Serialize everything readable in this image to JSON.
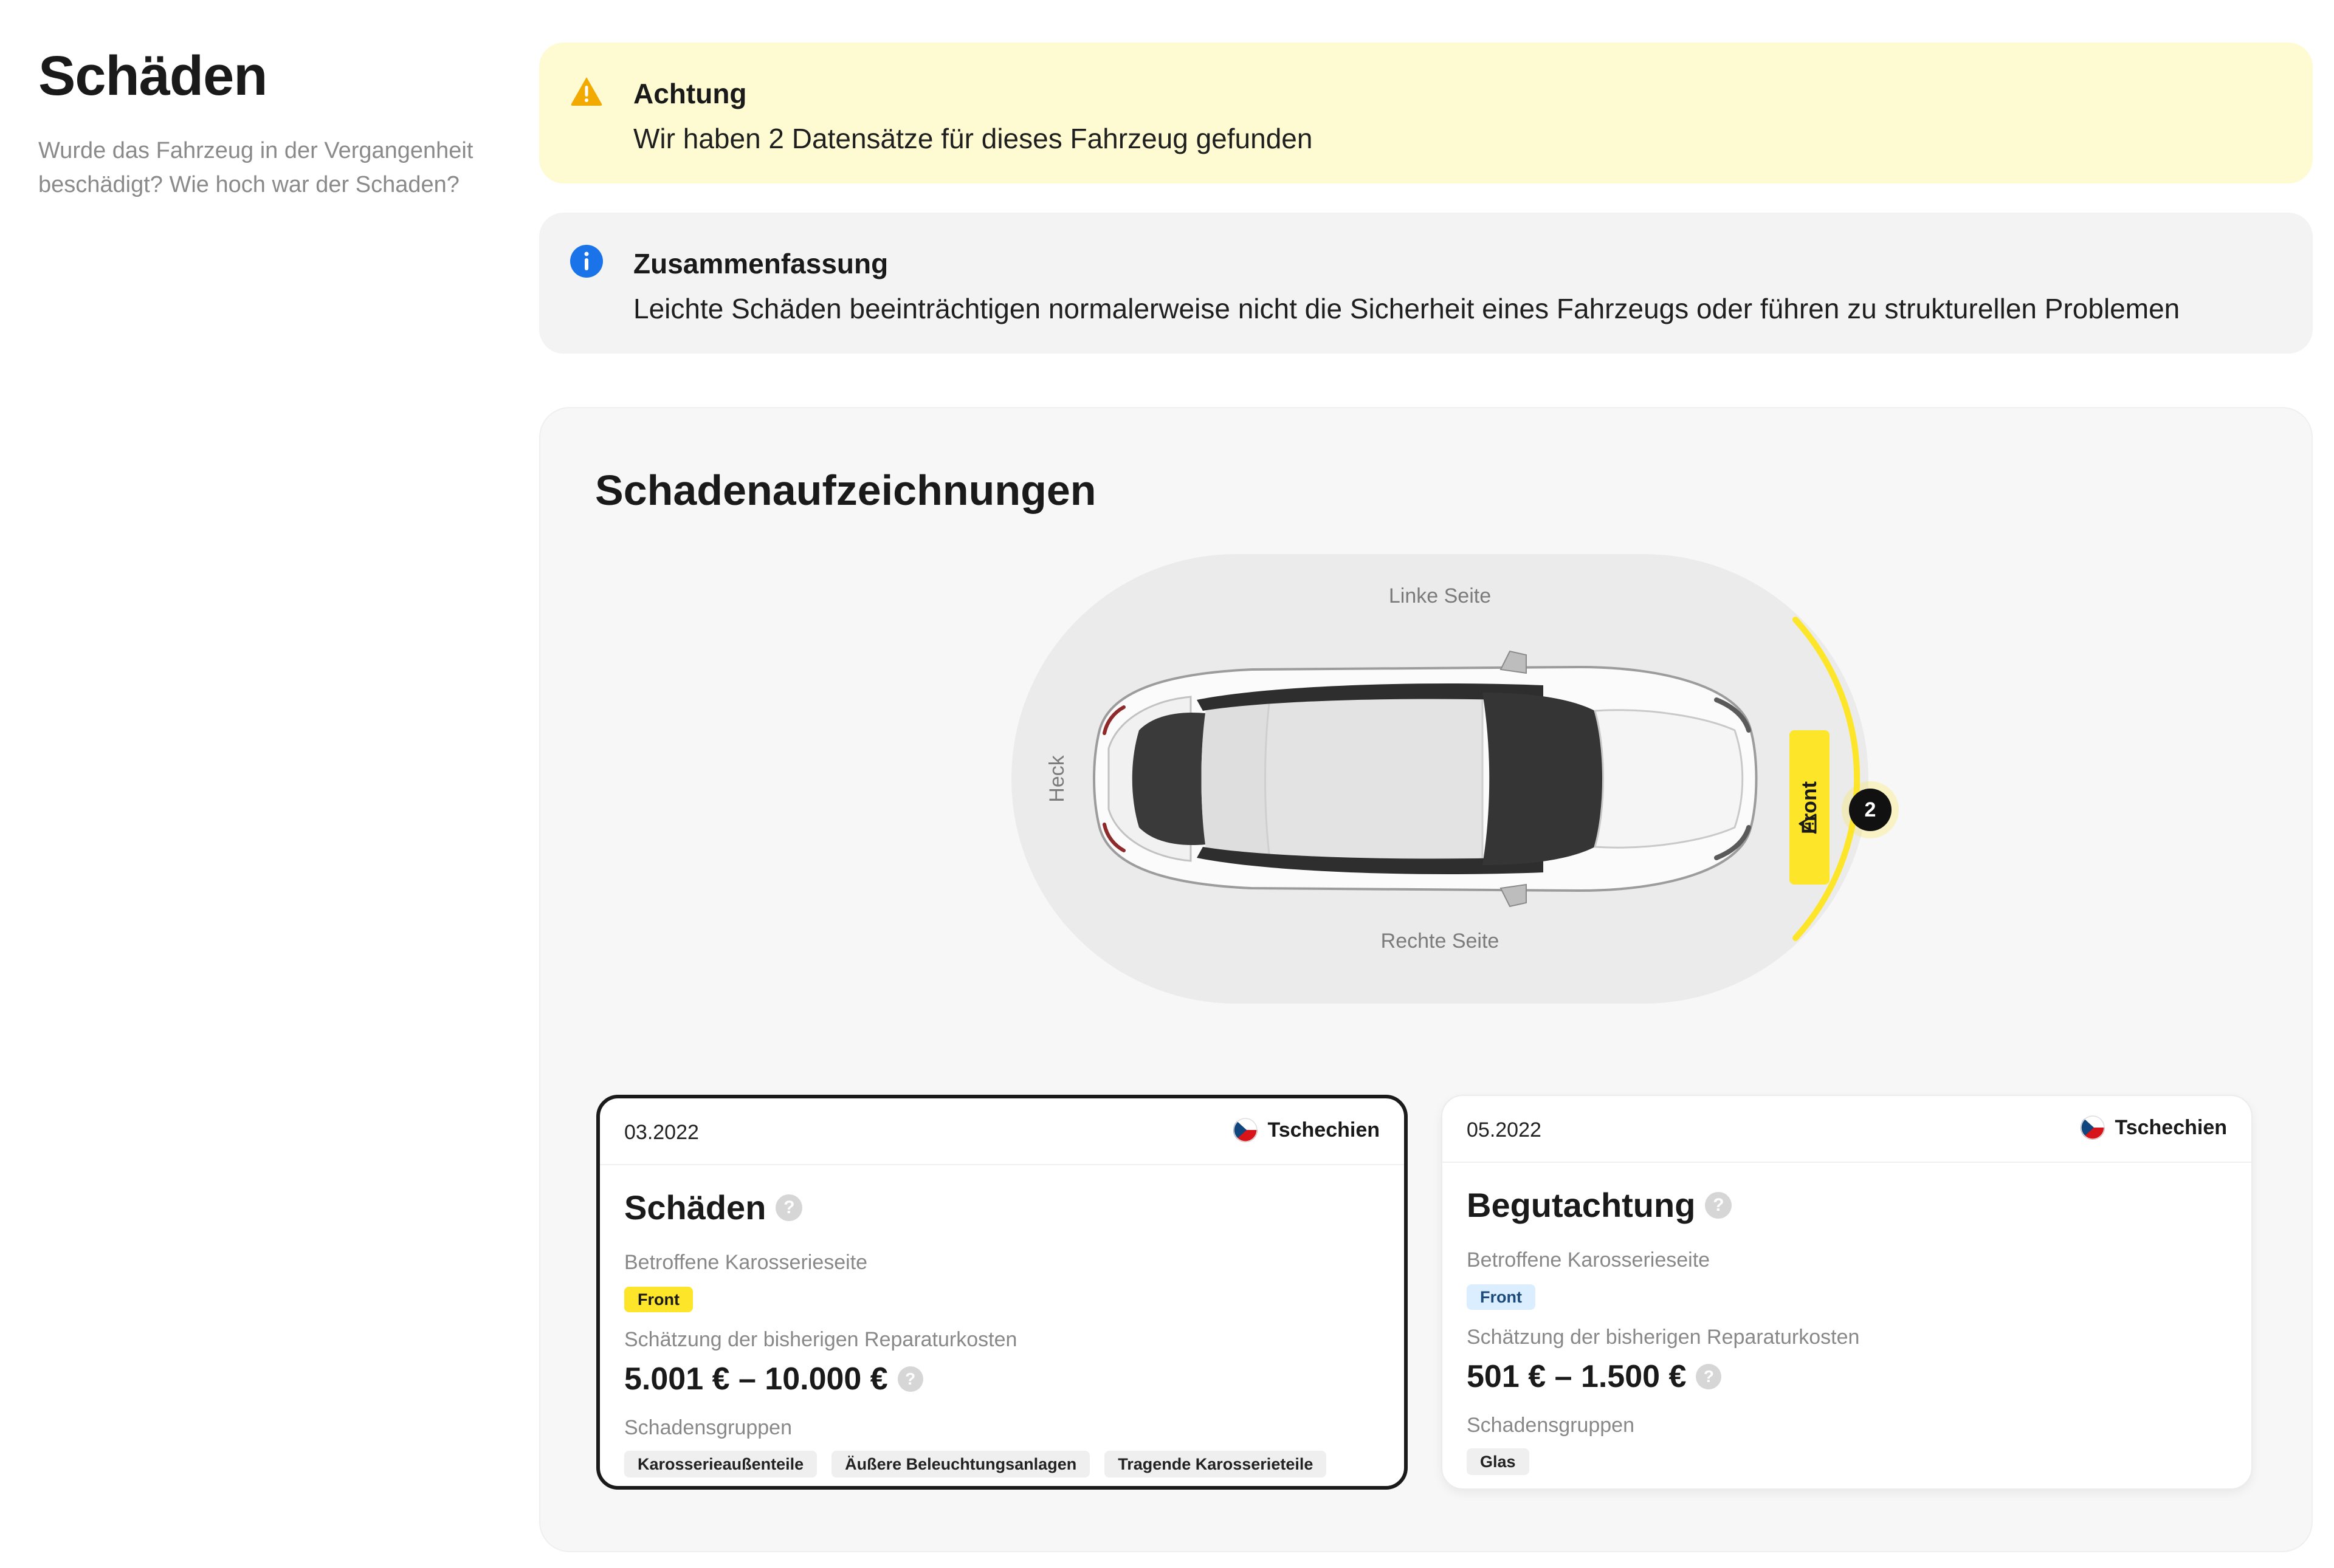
{
  "section": {
    "title": "Schäden",
    "subtitle": "Wurde das Fahrzeug in der Vergangenheit beschädigt? Wie hoch war der Schaden?"
  },
  "alerts": {
    "warning": {
      "title": "Achtung",
      "text": "Wir haben 2 Datensätze für dieses Fahrzeug gefunden",
      "color": "#fefbd3",
      "icon": "warning-icon"
    },
    "info": {
      "title": "Zusammenfassung",
      "text": "Leichte Schäden beeinträchtigen normalerweise nicht die Sicherheit eines Fahrzeugs oder führen zu strukturellen Problemen",
      "color": "#f3f3f3",
      "icon": "info-icon"
    }
  },
  "records": {
    "title": "Schadenaufzeichnungen",
    "diagram": {
      "left_side": "Linke Seite",
      "right_side": "Rechte Seite",
      "rear": "Heck",
      "front": "Front",
      "front_count": "2",
      "highlight_color": "#fde52a"
    },
    "cards": [
      {
        "date": "03.2022",
        "country": "Tschechien",
        "title": "Schäden",
        "side_label": "Betroffene Karosserieseite",
        "side": "Front",
        "cost_label": "Schätzung der bisherigen Reparaturkosten",
        "cost": "5.001 € – 10.000 €",
        "groups_label": "Schadensgruppen",
        "groups": [
          "Karosserieaußenteile",
          "Äußere Beleuchtungsanlagen",
          "Tragende Karosserieteile"
        ],
        "selected": true
      },
      {
        "date": "05.2022",
        "country": "Tschechien",
        "title": "Begutachtung",
        "side_label": "Betroffene Karosserieseite",
        "side": "Front",
        "cost_label": "Schätzung der bisherigen Reparaturkosten",
        "cost": "501 € – 1.500 €",
        "groups_label": "Schadensgruppen",
        "groups": [
          "Glas"
        ],
        "selected": false
      }
    ],
    "help_glyph": "?"
  }
}
